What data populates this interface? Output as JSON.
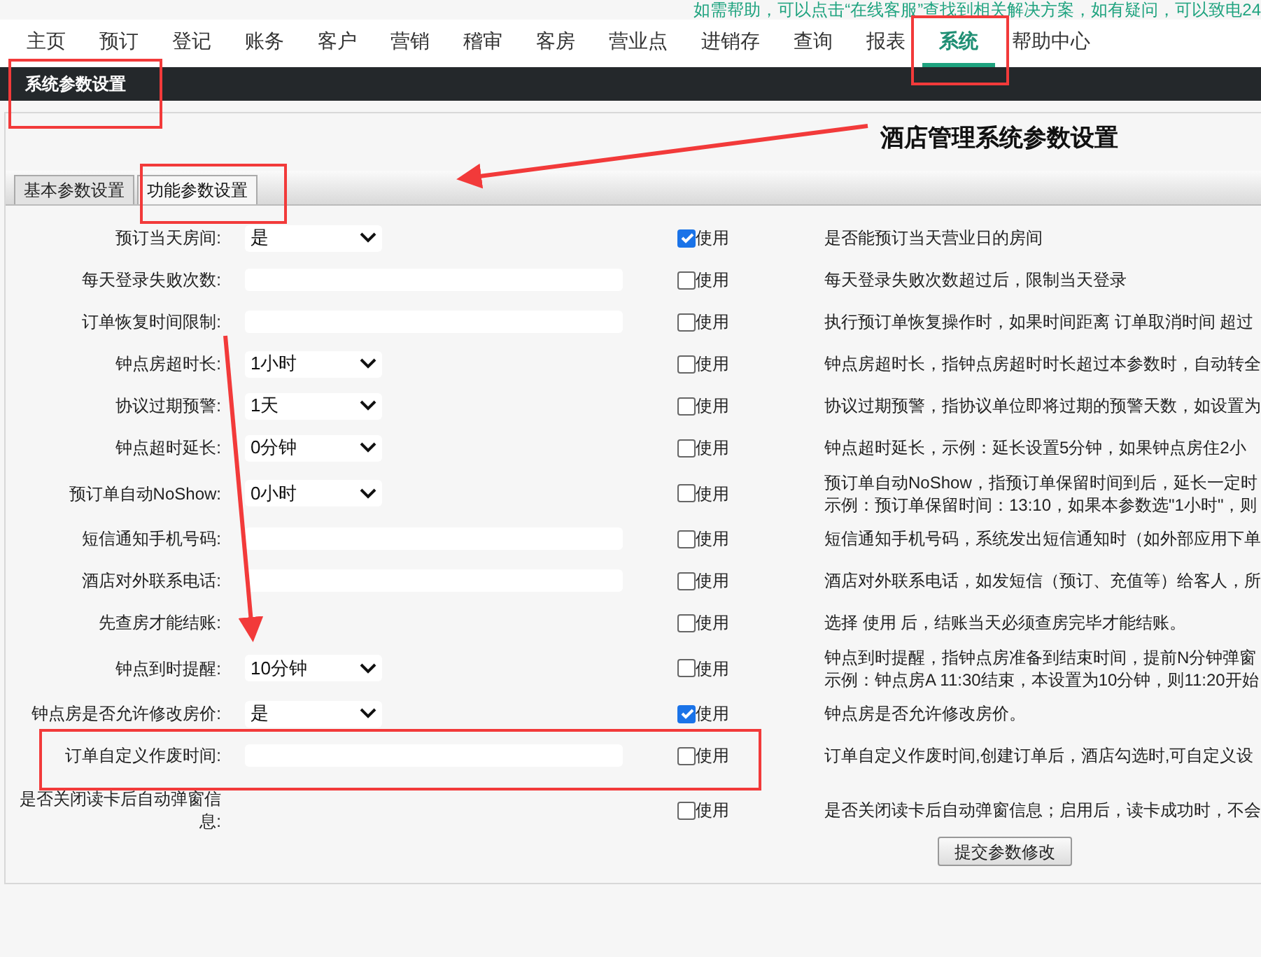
{
  "help_text": "如需帮助，可以点击“在线客服”查找到相关解决方案，如有疑问，可以致电24",
  "nav": [
    {
      "label": "主页",
      "selected": false
    },
    {
      "label": "预订",
      "selected": false
    },
    {
      "label": "登记",
      "selected": false
    },
    {
      "label": "账务",
      "selected": false
    },
    {
      "label": "客户",
      "selected": false
    },
    {
      "label": "营销",
      "selected": false
    },
    {
      "label": "稽审",
      "selected": false
    },
    {
      "label": "客房",
      "selected": false
    },
    {
      "label": "营业点",
      "selected": false
    },
    {
      "label": "进销存",
      "selected": false
    },
    {
      "label": "查询",
      "selected": false
    },
    {
      "label": "报表",
      "selected": false
    },
    {
      "label": "系统",
      "selected": true
    },
    {
      "label": "帮助中心",
      "selected": false
    }
  ],
  "section_title": "系统参数设置",
  "page_title": "酒店管理系统参数设置",
  "tabs": [
    {
      "label": "基本参数设置",
      "selected": false
    },
    {
      "label": "功能参数设置",
      "selected": true
    }
  ],
  "rows": [
    {
      "label": "预订当天房间:",
      "kind": "select",
      "value": "是",
      "checkbox_label": "使用",
      "checked": true,
      "description": [
        "是否能预订当天营业日的房间"
      ]
    },
    {
      "label": "每天登录失败次数:",
      "kind": "input",
      "checkbox_label": "使用",
      "checked": false,
      "description": [
        "每天登录失败次数超过后，限制当天登录"
      ]
    },
    {
      "label": "订单恢复时间限制:",
      "kind": "input",
      "checkbox_label": "使用",
      "checked": false,
      "description": [
        "执行预订单恢复操作时，如果时间距离 订单取消时间 超过"
      ]
    },
    {
      "label": "钟点房超时长:",
      "kind": "select",
      "value": "1小时",
      "checkbox_label": "使用",
      "checked": false,
      "description": [
        "钟点房超时长，指钟点房超时时长超过本参数时，自动转全"
      ]
    },
    {
      "label": "协议过期预警:",
      "kind": "select",
      "value": "1天",
      "checkbox_label": "使用",
      "checked": false,
      "description": [
        "协议过期预警，指协议单位即将过期的预警天数，如设置为"
      ]
    },
    {
      "label": "钟点超时延长:",
      "kind": "select",
      "value": "0分钟",
      "checkbox_label": "使用",
      "checked": false,
      "description": [
        "钟点超时延长，示例：延长设置5分钟，如果钟点房住2小"
      ]
    },
    {
      "label": "预订单自动NoShow:",
      "kind": "select",
      "value": "0小时",
      "checkbox_label": "使用",
      "checked": false,
      "description": [
        "预订单自动NoShow，指预订单保留时间到后，延长一定时",
        "示例：预订单保留时间：13:10，如果本参数选\"1小时\"，则"
      ]
    },
    {
      "label": "短信通知手机号码:",
      "kind": "input",
      "checkbox_label": "使用",
      "checked": false,
      "description": [
        "短信通知手机号码，系统发出短信通知时（如外部应用下单"
      ]
    },
    {
      "label": "酒店对外联系电话:",
      "kind": "input",
      "checkbox_label": "使用",
      "checked": false,
      "description": [
        "酒店对外联系电话，如发短信（预订、充值等）给客人，所"
      ]
    },
    {
      "label": "先查房才能结账:",
      "kind": "none",
      "checkbox_label": "使用",
      "checked": false,
      "description": [
        "选择 使用 后，结账当天必须查房完毕才能结账。"
      ]
    },
    {
      "label": "钟点到时提醒:",
      "kind": "select",
      "value": "10分钟",
      "checkbox_label": "使用",
      "checked": false,
      "description": [
        "钟点到时提醒，指钟点房准备到结束时间，提前N分钟弹窗",
        "示例：钟点房A 11:30结束，本设置为10分钟，则11:20开始"
      ]
    },
    {
      "label": "钟点房是否允许修改房价:",
      "kind": "select",
      "value": "是",
      "checkbox_label": "使用",
      "checked": true,
      "description": [
        "钟点房是否允许修改房价。"
      ]
    },
    {
      "label": "订单自定义作废时间:",
      "kind": "input",
      "checkbox_label": "使用",
      "checked": false,
      "description": [
        "订单自定义作废时间,创建订单后，酒店勾选时,可自定义设"
      ]
    },
    {
      "label": "是否关闭读卡后自动弹窗信息:",
      "kind": "none",
      "checkbox_label": "使用",
      "checked": false,
      "description": [
        "是否关闭读卡后自动弹窗信息；启用后，读卡成功时，不会"
      ]
    }
  ],
  "submit_button": "提交参数修改"
}
